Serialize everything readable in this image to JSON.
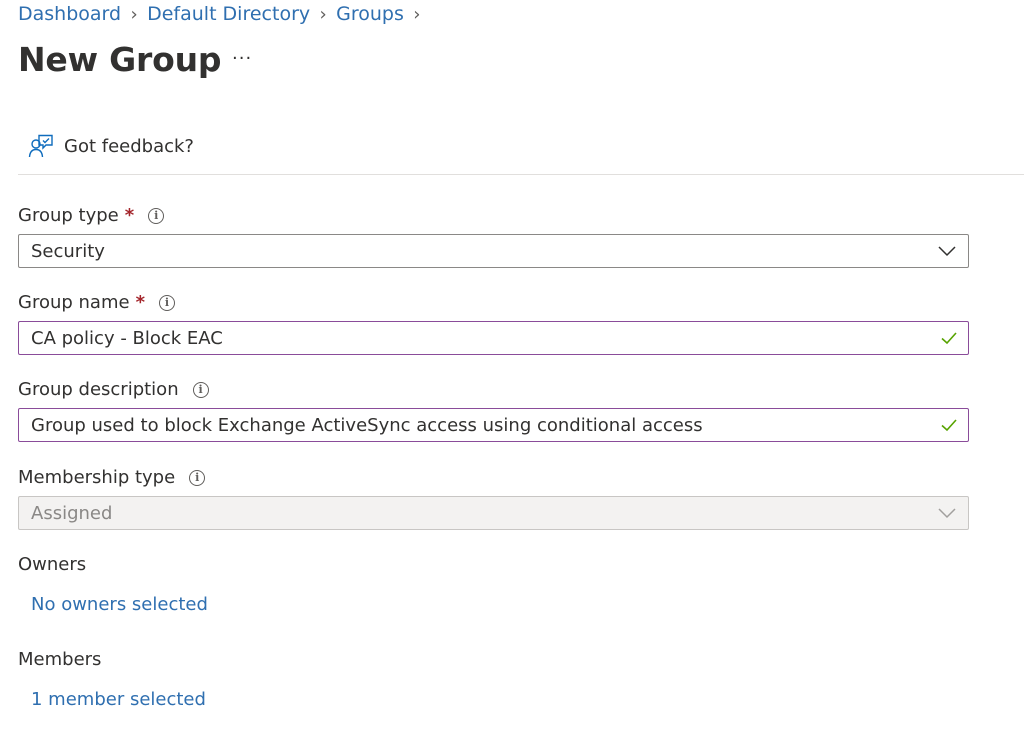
{
  "breadcrumb": {
    "items": [
      "Dashboard",
      "Default Directory",
      "Groups"
    ],
    "separator": ">"
  },
  "page": {
    "title": "New Group",
    "more_label": "···"
  },
  "toolbar": {
    "feedback_label": "Got feedback?"
  },
  "form": {
    "group_type": {
      "label": "Group type",
      "required_mark": "*",
      "value": "Security"
    },
    "group_name": {
      "label": "Group name",
      "required_mark": "*",
      "value": "CA policy - Block EAC"
    },
    "group_description": {
      "label": "Group description",
      "value": "Group used to block Exchange ActiveSync access using conditional access"
    },
    "membership_type": {
      "label": "Membership type",
      "value": "Assigned"
    },
    "owners": {
      "label": "Owners",
      "link": "No owners selected"
    },
    "members": {
      "label": "Members",
      "link": "1 member selected"
    }
  },
  "colors": {
    "link": "#2f6fb0",
    "required": "#a4262c",
    "valid_check": "#57a300",
    "valid_border": "#8a4c9a"
  }
}
